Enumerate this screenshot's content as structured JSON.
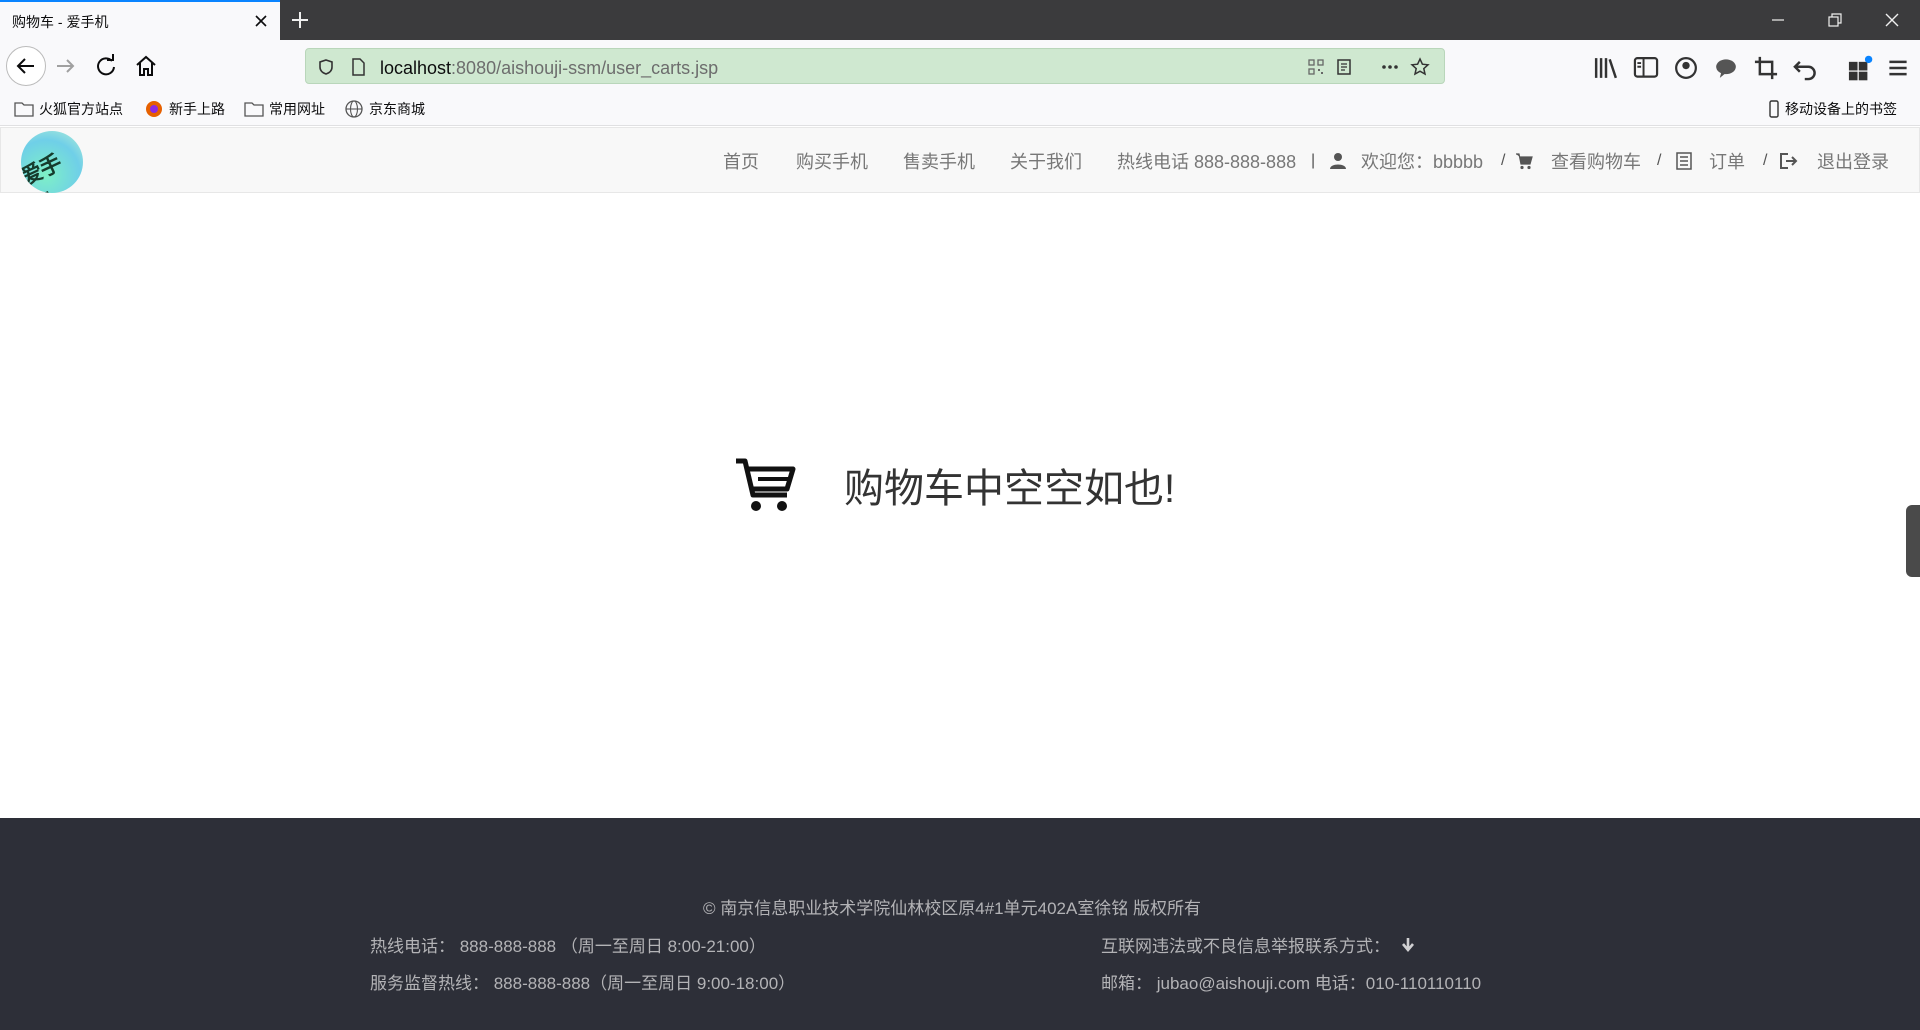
{
  "browser": {
    "tab_title": "购物车 - 爱手机",
    "url_host": "localhost",
    "url_rest": ":8080/aishouji-ssm/user_carts.jsp",
    "bookmarks": [
      "火狐官方站点",
      "新手上路",
      "常用网址",
      "京东商城"
    ],
    "mobile_bookmarks": "移动设备上的书签"
  },
  "site": {
    "logo_text": "爱手机",
    "menu": {
      "home": "首页",
      "buy": "购买手机",
      "sell": "售卖手机",
      "about": "关于我们",
      "hotline": "热线电话 888-888-888",
      "welcome": "欢迎您：bbbbb",
      "cart": "查看购物车",
      "orders": "订单",
      "logout": "退出登录",
      "sep_pipe": "|",
      "sep_slash": "/"
    }
  },
  "main": {
    "empty_message": "购物车中空空如也!"
  },
  "footer": {
    "copyright": "© 南京信息职业技术学院仙林校区原4#1单元402A室徐铭 版权所有",
    "hotline": "热线电话：  888-888-888 （周一至周日 8:00-21:00）",
    "supervision": "服务监督热线：  888-888-888（周一至周日 9:00-18:00）",
    "report": "互联网违法或不良信息举报联系方式：",
    "email": "邮箱：  jubao@aishouji.com 电话：010-110110110"
  }
}
